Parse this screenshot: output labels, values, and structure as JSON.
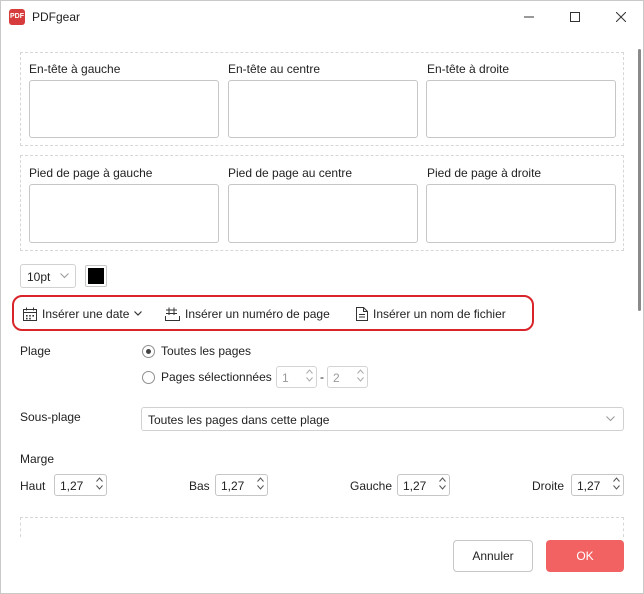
{
  "window": {
    "title": "PDFgear",
    "logo_text": "PDF"
  },
  "header": {
    "left_label": "En-tête à gauche",
    "center_label": "En-tête au centre",
    "right_label": "En-tête à droite",
    "left_value": "",
    "center_value": "",
    "right_value": ""
  },
  "footer": {
    "left_label": "Pied de page à gauche",
    "center_label": "Pied de page au centre",
    "right_label": "Pied de page à droite",
    "left_value": "",
    "center_value": "",
    "right_value": ""
  },
  "format": {
    "font_size": "10pt",
    "text_color": "#000000"
  },
  "toolbar": {
    "insert_date": "Insérer une date",
    "insert_page_number": "Insérer un numéro de page",
    "insert_file_name": "Insérer un nom de fichier"
  },
  "range": {
    "label": "Plage",
    "all_pages": "Toutes les pages",
    "selected_pages": "Pages sélectionnées",
    "from": "1",
    "separator": "-",
    "to": "2",
    "selected_option": "all_pages"
  },
  "subrange": {
    "label": "Sous-plage",
    "value": "Toutes les pages dans cette plage"
  },
  "margin": {
    "label": "Marge",
    "top_label": "Haut",
    "top_value": "1,27",
    "bottom_label": "Bas",
    "bottom_value": "1,27",
    "left_label": "Gauche",
    "left_value": "1,27",
    "right_label": "Droite",
    "right_value": "1,27"
  },
  "actions": {
    "cancel": "Annuler",
    "ok": "OK"
  },
  "colors": {
    "accent": "#f26262",
    "highlight": "#d9252a"
  }
}
